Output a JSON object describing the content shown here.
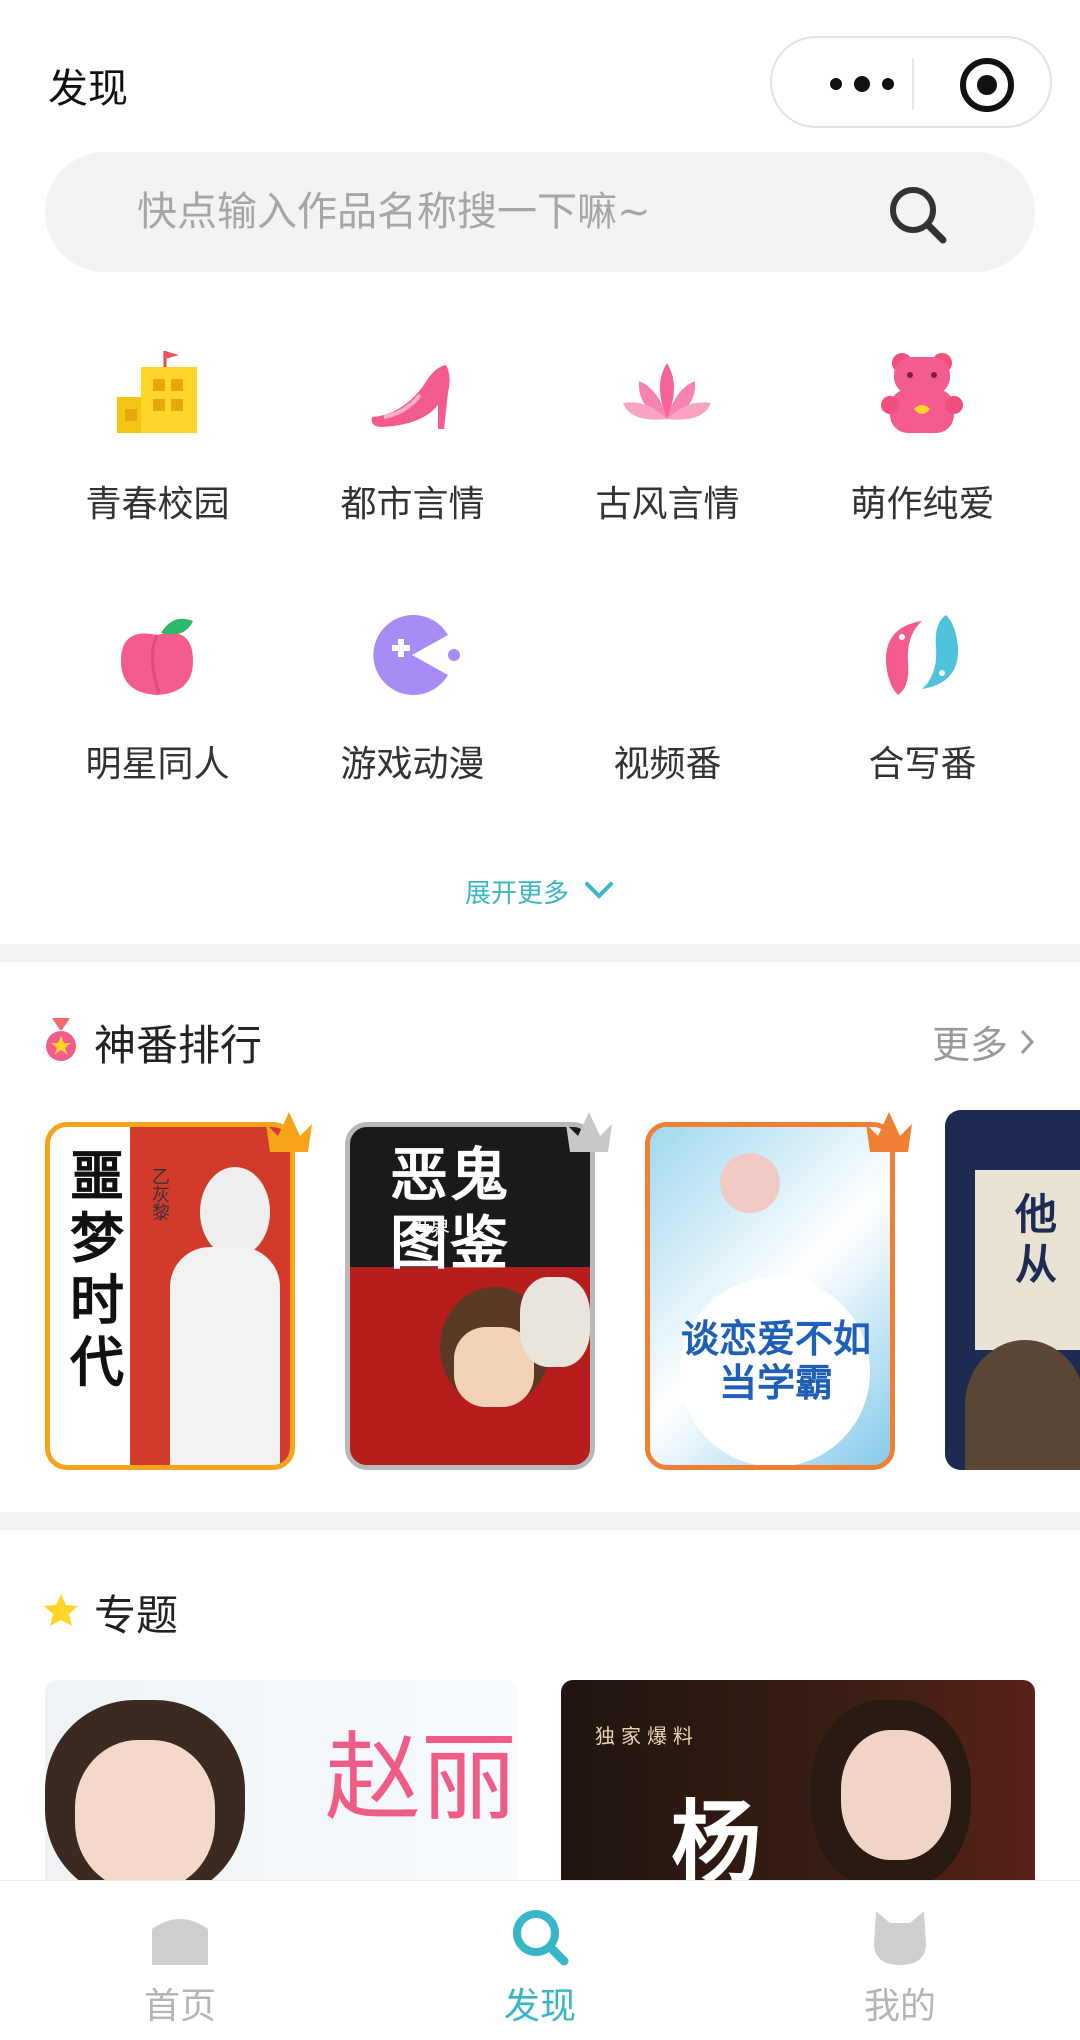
{
  "header": {
    "title": "发现"
  },
  "search": {
    "placeholder": "快点输入作品名称搜一下嘛~"
  },
  "categories": [
    {
      "label": "青春校园",
      "icon": "school-building-icon"
    },
    {
      "label": "都市言情",
      "icon": "high-heel-icon"
    },
    {
      "label": "古风言情",
      "icon": "lotus-icon"
    },
    {
      "label": "萌作纯爱",
      "icon": "gummy-bear-icon"
    },
    {
      "label": "明星同人",
      "icon": "peach-icon"
    },
    {
      "label": "游戏动漫",
      "icon": "pacman-icon"
    },
    {
      "label": "视频番",
      "icon": ""
    },
    {
      "label": "合写番",
      "icon": "dolphins-icon"
    }
  ],
  "expand": {
    "label": "展开更多"
  },
  "ranking": {
    "title": "神番排行",
    "more": "更多",
    "books": [
      {
        "cover_title": "噩梦时代",
        "cover_sub": "乙灰黎"
      },
      {
        "cover_title": "恶鬼图鉴",
        "cover_sub": "世界"
      },
      {
        "cover_title": "谈恋爱不如当学霸",
        "cover_sub": ""
      },
      {
        "cover_title": "他从",
        "cover_sub": ""
      }
    ]
  },
  "topics": {
    "title": "专题",
    "items": [
      {
        "cover_text": "赵丽"
      },
      {
        "cover_text": "杨",
        "tagline": "独家爆料"
      }
    ]
  },
  "tabbar": [
    {
      "label": "首页",
      "icon": "home-icon",
      "active": false
    },
    {
      "label": "发现",
      "icon": "discover-search-icon",
      "active": true
    },
    {
      "label": "我的",
      "icon": "cat-profile-icon",
      "active": false
    }
  ],
  "colors": {
    "accent": "#39b6c5",
    "pink": "#f45b8f",
    "yellow": "#f6c514",
    "purple": "#a88cf5"
  }
}
